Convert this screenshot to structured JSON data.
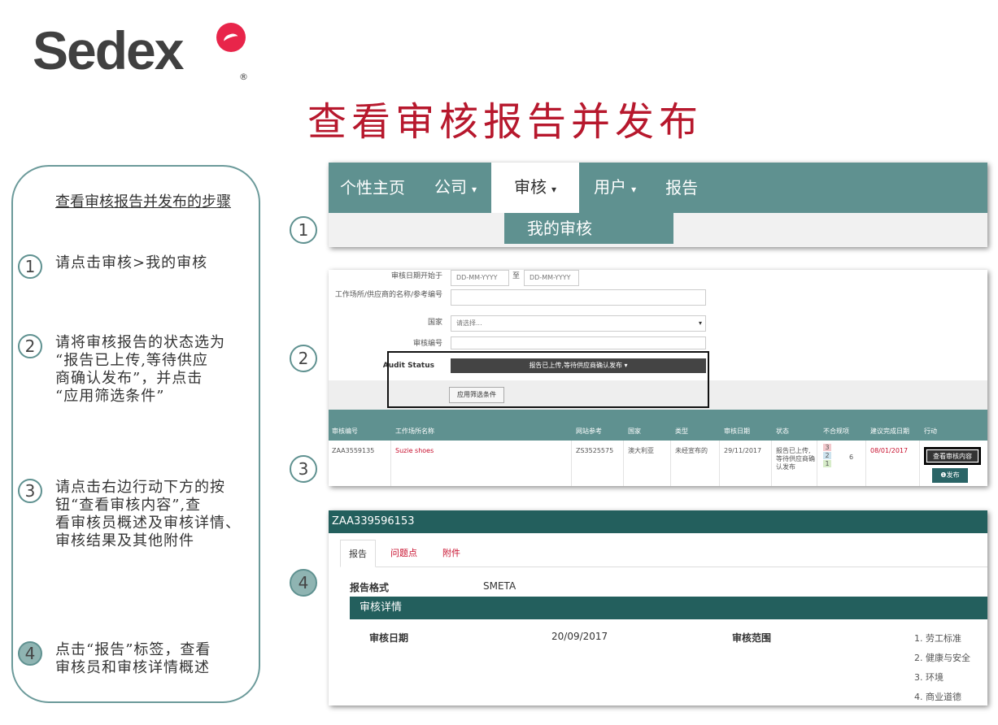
{
  "logo": {
    "text": "Sedex",
    "reg": "®"
  },
  "page_title": "查看审核报告并发布",
  "sidebar": {
    "title": "查看审核报告并发布的步骤",
    "steps": [
      {
        "num": "1",
        "text": "请点击审核>我的审核"
      },
      {
        "num": "2",
        "text": "请将审核报告的状态选为\n“报告已上传,等待供应\n商确认发布”，并点击\n“应用筛选条件”"
      },
      {
        "num": "3",
        "text": "请点击右边行动下方的按\n钮“查看审核内容”,查\n看审核员概述及审核详情、\n审核结果及其他附件"
      },
      {
        "num": "4",
        "text": "点击“报告”标签，查看\n审核员和审核详情概述"
      }
    ]
  },
  "badges": [
    "1",
    "2",
    "3",
    "4"
  ],
  "nav": {
    "items": [
      {
        "label": "个性主页",
        "dropdown": false
      },
      {
        "label": "公司",
        "dropdown": true
      },
      {
        "label": "审核",
        "dropdown": true,
        "active": true
      },
      {
        "label": "用户",
        "dropdown": true
      },
      {
        "label": "报告",
        "dropdown": false
      }
    ],
    "caret": "▾",
    "submenu": "我的审核"
  },
  "filter": {
    "date_label": "审核日期开始于",
    "date_from_placeholder": "DD-MM-YYYY",
    "to": "至",
    "date_to_placeholder": "DD-MM-YYYY",
    "site_label": "工作场所/供应商的名称/参考编号",
    "country_label": "国家",
    "country_value": "请选择...",
    "audit_no_label": "审核编号",
    "status_label": "Audit Status",
    "status_value": "报告已上传,等待供应商确认发布 ▾",
    "apply_button": "应用筛选条件"
  },
  "table": {
    "headers": [
      "审核编号",
      "工作场所名称",
      "网站参考",
      "国家",
      "类型",
      "审核日期",
      "状态",
      "不合规项",
      "建议完成日期",
      "行动"
    ],
    "row": {
      "audit_no": "ZAA3559135",
      "site": "Suzie shoes",
      "ref": "ZS3525575",
      "country": "澳大利亚",
      "type": "未经宣布的",
      "date": "29/11/2017",
      "status": "报告已上传,等待供应商确认发布",
      "nc": [
        "3",
        "2",
        "1"
      ],
      "nc_total": "6",
      "due": "08/01/2017",
      "view_button": "查看审核内容",
      "publish_button": "❶发布"
    }
  },
  "report": {
    "id": "ZAA339596153",
    "tabs": [
      "报告",
      "问题点",
      "附件"
    ],
    "format_label": "报告格式",
    "format_value": "SMETA",
    "details_title": "审核详情",
    "date_label": "审核日期",
    "date_value": "20/09/2017",
    "scope_label": "审核范围",
    "scope_items": [
      "1. 劳工标准",
      "2. 健康与安全",
      "3. 环境",
      "4. 商业道德"
    ]
  },
  "colors": {
    "teal": "#5f9190",
    "dark_teal": "#235f5d",
    "title_red": "#b7182d",
    "logo_red": "#e8254a"
  }
}
